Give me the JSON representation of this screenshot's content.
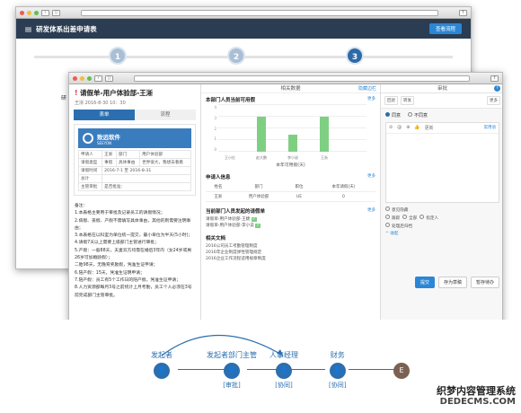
{
  "back_window": {
    "title": "研发体系出差申请表",
    "button": "查看流程",
    "steps": [
      "1",
      "2",
      "3"
    ],
    "side_fragment": "研"
  },
  "front_window": {
    "form_title": "请假单-用户体验部-王淅",
    "title_mark": "!",
    "meta": "王淅    2016-8-30 10：30",
    "tabs": [
      "表单",
      "流程"
    ],
    "logo_text": "致远软件",
    "logo_sub": "SEEYON",
    "form_rows": [
      [
        "申请人",
        "王淅",
        "部门",
        "用户体验部"
      ],
      [
        "请假类型",
        "事假",
        "具体事由",
        "世界很大，我想去看看"
      ],
      [
        "请假时间",
        "2016-7-1 至 2016-8-31",
        "",
        ""
      ],
      [
        "总计",
        "",
        "",
        ""
      ],
      [
        "主管审批",
        "是否批准：",
        "",
        ""
      ]
    ],
    "notes": [
      "备注：",
      "1.本表格主要用于审批及记录员工的请假情况；",
      "2.病假、丧假、产假不需填写具体事由，其他的则需要注明事由；",
      "3.本表格在以科室为单位统一提交，最小单位为半天(5小时)；",
      "4.请假7天以上需要上级部门主管进行审批；",
      "5.产假：一般88天，夫妻双方均需在婚后3年内（女24岁或男26岁可加婚龄假）；",
      "二胎98天，无晚育奖励假，凭准生证申请；",
      "6.陪产假：15天，凭准生证明申请；",
      "7.陪产假：员工有5个工作日的陪产假，凭准生证申请；",
      "8.人力资源部每月3号之前统计上月考勤，员工个人必须在3号前完成部门主管审批。"
    ],
    "related": {
      "header": "相关数据",
      "header_link": "隐藏边栏",
      "chart_section": "本部门人员当前可用假",
      "more": "更多",
      "chart_caption": "本年可用假(天)",
      "applicant_section": "申请人信息",
      "applicant_headers": [
        "姓名",
        "部门",
        "职位",
        "本年请假(天)"
      ],
      "applicant_row": [
        "王淅",
        "用户体验部",
        "UE",
        "0"
      ],
      "dept_section": "当前部门人员发起的请假单",
      "dept_items": [
        "请假单-用户体验部-王婕",
        "请假单-用户体验部-李小说"
      ],
      "docs_section": "相关文档",
      "docs_items": [
        "2016公司员工考勤管理制度",
        "2016年企业制度弹性管理规定",
        "2016企业工作流程适用规章制度"
      ]
    },
    "approval": {
      "header": "审批",
      "help": "?",
      "toolbar": [
        "回退",
        "转发",
        "更多"
      ],
      "radios": [
        "同意",
        "不同意"
      ],
      "comment_tools": [
        "⊘",
        "@",
        "⊕",
        "👍",
        "更新"
      ],
      "comment_more": "常用语",
      "options": [
        "意见隐藏",
        "跟踪",
        "全部",
        "指定人",
        "处理后归档"
      ],
      "collapse": "收起",
      "buttons": [
        "提交",
        "存为草稿",
        "暂存待办"
      ]
    }
  },
  "flow": {
    "nodes": [
      {
        "label": "发起者",
        "tag": ""
      },
      {
        "label": "发起者部门主管",
        "tag": "[审批]"
      },
      {
        "label": "人事经理",
        "tag": "[协同]"
      },
      {
        "label": "财务",
        "tag": "[协同]"
      },
      {
        "label": "E",
        "tag": ""
      }
    ]
  },
  "chart_data": {
    "type": "bar",
    "title": "本部门人员当前可用假",
    "categories": [
      "王小红",
      "赵大鹏",
      "李小说",
      "王淅"
    ],
    "values": [
      0,
      3,
      1.5,
      3
    ],
    "xlabel": "本年可用假(天)",
    "ylabel": "",
    "ylim": [
      0,
      4
    ],
    "colors": {
      "bar": "#7fcf83"
    }
  },
  "watermark": {
    "line1": "织梦内容管理系统",
    "line2": "DEDECMS.COM"
  }
}
